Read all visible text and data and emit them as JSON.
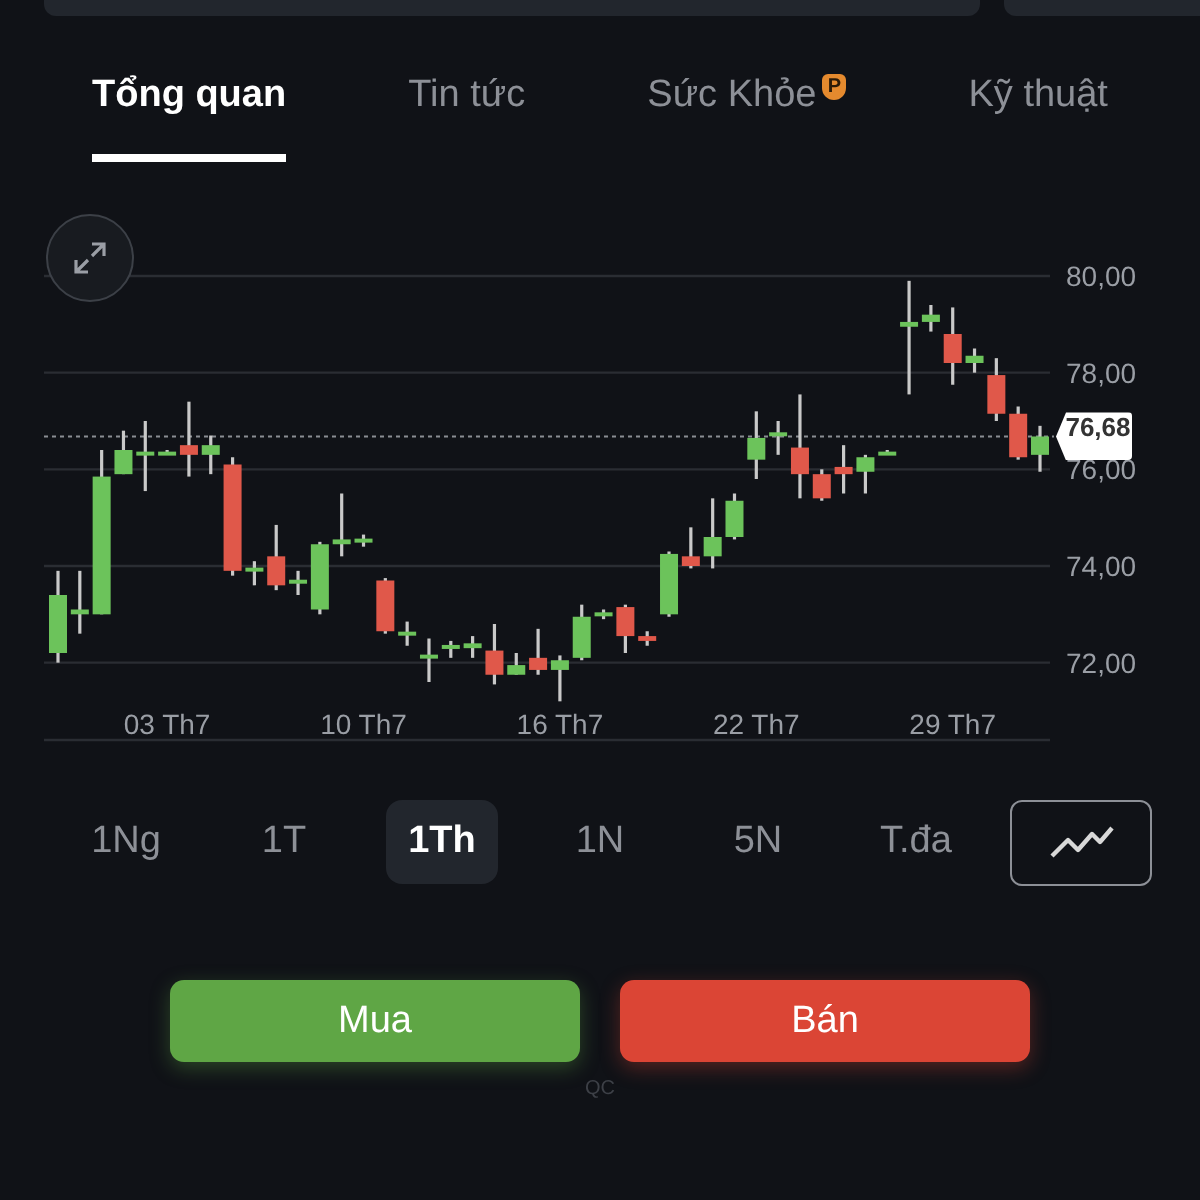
{
  "tabs": [
    {
      "label": "Tổng quan",
      "selected": true
    },
    {
      "label": "Tin tức",
      "selected": false
    },
    {
      "label": "Sức Khỏe",
      "selected": false,
      "badge": "P"
    },
    {
      "label": "Kỹ thuật",
      "selected": false
    }
  ],
  "chart": {
    "chart_data": {
      "type": "candlestick",
      "grid": true,
      "ylim": [
        70.4,
        80
      ],
      "categories": [
        null,
        null,
        null,
        null,
        null,
        "03 Th7",
        null,
        null,
        null,
        null,
        null,
        null,
        null,
        null,
        "10 Th7",
        null,
        null,
        null,
        null,
        null,
        null,
        null,
        null,
        "16 Th7",
        null,
        null,
        null,
        null,
        null,
        null,
        null,
        null,
        "22 Th7",
        null,
        null,
        null,
        null,
        null,
        null,
        null,
        null,
        "29 Th7",
        null,
        null,
        null,
        null
      ],
      "yticks": [
        {
          "value": 72,
          "label": "72,00"
        },
        {
          "value": 74,
          "label": "74,00"
        },
        {
          "value": 76,
          "label": "76,00"
        },
        {
          "value": 78,
          "label": "78,00"
        },
        {
          "value": 80,
          "label": "80,00"
        }
      ],
      "ohlc": [
        [
          72.2,
          73.9,
          72.0,
          73.4
        ],
        [
          73.0,
          73.9,
          72.6,
          73.1
        ],
        [
          73.0,
          76.4,
          73.0,
          75.85
        ],
        [
          75.9,
          76.8,
          75.9,
          76.4
        ],
        [
          76.3,
          77.0,
          75.55,
          76.35
        ],
        [
          76.3,
          76.4,
          76.3,
          76.35
        ],
        [
          76.5,
          77.4,
          75.85,
          76.3
        ],
        [
          76.3,
          76.7,
          75.9,
          76.5
        ],
        [
          76.1,
          76.25,
          73.8,
          73.9
        ],
        [
          73.9,
          74.1,
          73.6,
          73.95
        ],
        [
          74.2,
          74.85,
          73.5,
          73.6
        ],
        [
          73.65,
          73.9,
          73.4,
          73.7
        ],
        [
          73.1,
          74.5,
          73.0,
          74.45
        ],
        [
          74.45,
          75.5,
          74.2,
          74.55
        ],
        [
          74.5,
          74.65,
          74.4,
          74.55
        ],
        [
          73.7,
          73.75,
          72.6,
          72.65
        ],
        [
          72.6,
          72.85,
          72.35,
          72.6
        ],
        [
          72.1,
          72.5,
          71.6,
          72.15
        ],
        [
          72.3,
          72.45,
          72.1,
          72.35
        ],
        [
          72.3,
          72.55,
          72.1,
          72.4
        ],
        [
          72.25,
          72.8,
          71.55,
          71.75
        ],
        [
          71.75,
          72.2,
          71.75,
          71.95
        ],
        [
          72.1,
          72.7,
          71.75,
          71.85
        ],
        [
          71.85,
          72.15,
          71.2,
          72.05
        ],
        [
          72.1,
          73.2,
          72.05,
          72.95
        ],
        [
          73.0,
          73.1,
          72.9,
          73.0
        ],
        [
          73.15,
          73.2,
          72.2,
          72.55
        ],
        [
          72.55,
          72.65,
          72.35,
          72.45
        ],
        [
          73.0,
          74.3,
          72.95,
          74.25
        ],
        [
          74.2,
          74.8,
          73.95,
          74.0
        ],
        [
          74.2,
          75.4,
          73.95,
          74.6
        ],
        [
          74.6,
          75.5,
          74.55,
          75.35
        ],
        [
          76.2,
          77.2,
          75.8,
          76.65
        ],
        [
          76.7,
          77.0,
          76.3,
          76.75
        ],
        [
          76.45,
          77.55,
          75.4,
          75.9
        ],
        [
          75.9,
          76.0,
          75.35,
          75.4
        ],
        [
          76.05,
          76.5,
          75.5,
          75.9
        ],
        [
          75.95,
          76.3,
          75.5,
          76.25
        ],
        [
          76.3,
          76.4,
          76.3,
          76.35
        ],
        [
          78.95,
          79.9,
          77.55,
          79.05
        ],
        [
          79.05,
          79.4,
          78.85,
          79.2
        ],
        [
          78.8,
          79.35,
          77.75,
          78.2
        ],
        [
          78.2,
          78.5,
          78.0,
          78.35
        ],
        [
          77.95,
          78.3,
          77.0,
          77.15
        ],
        [
          77.15,
          77.3,
          76.2,
          76.25
        ],
        [
          76.3,
          76.9,
          75.95,
          76.68
        ]
      ],
      "ref_lines": [
        {
          "axis": "y",
          "value": 76.68,
          "label": "76,68"
        }
      ]
    }
  },
  "ranges": [
    {
      "label": "1Ng",
      "selected": false
    },
    {
      "label": "1T",
      "selected": false
    },
    {
      "label": "1Th",
      "selected": true
    },
    {
      "label": "1N",
      "selected": false
    },
    {
      "label": "5N",
      "selected": false
    },
    {
      "label": "T.đa",
      "selected": false
    }
  ],
  "actions": [
    {
      "label": "Mua",
      "kind": "buy"
    },
    {
      "label": "Bán",
      "kind": "sell"
    }
  ],
  "ad_label": "QC"
}
